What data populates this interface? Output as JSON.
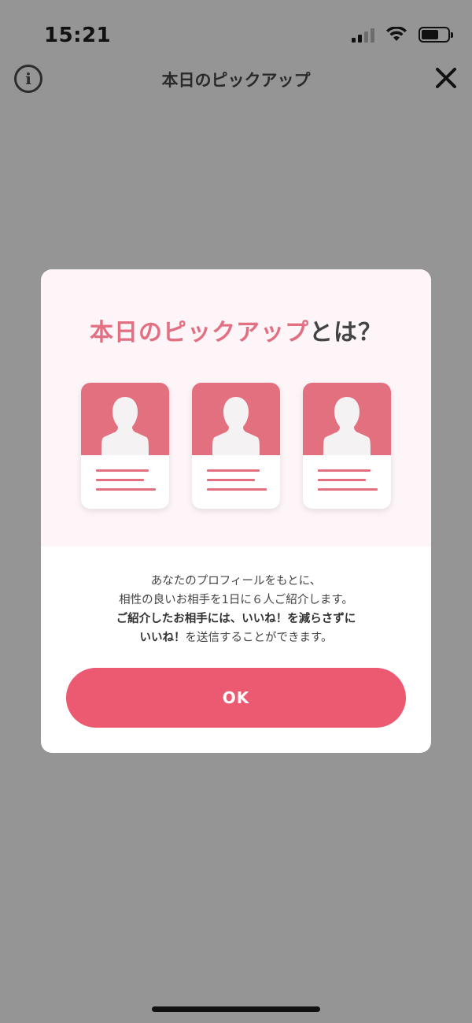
{
  "status_bar": {
    "time": "15:21"
  },
  "nav": {
    "title": "本日のピックアップ"
  },
  "modal": {
    "heading_highlight": "本日のピックアップ",
    "heading_rest": "とは？",
    "body_line1": "あなたのプロフィールをもとに、",
    "body_line2": "相性の良いお相手を1日に６人ご紹介します。",
    "body_line3": "ご紹介したお相手には、いいね！を減らさずに",
    "body_line4_bold": "いいね！",
    "body_line4_rest": "を送信することができます。",
    "ok_label": "OK"
  },
  "colors": {
    "accent": "#ec5a72",
    "card_pink": "#e3707f",
    "overlay": "#959595",
    "modal_top_bg": "#fdf5f7"
  },
  "icons": {
    "info": "info-icon",
    "close": "close-icon",
    "signal": "signal-icon",
    "wifi": "wifi-icon",
    "battery": "battery-icon",
    "profile": "person-silhouette-icon"
  }
}
